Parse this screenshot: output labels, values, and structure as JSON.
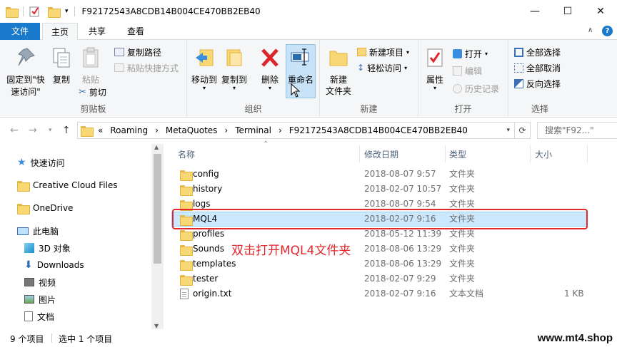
{
  "window": {
    "title": "F92172543A8CDB14B004CE470BB2EB40",
    "minimize": "—",
    "maximize": "☐",
    "close": "✕"
  },
  "ribbon_tabs": {
    "file": "文件",
    "home": "主页",
    "share": "共享",
    "view": "查看"
  },
  "ribbon": {
    "clipboard": {
      "label": "剪贴板",
      "pin_quick_access": "固定到\"快速访问\"",
      "copy": "复制",
      "paste": "粘贴",
      "copy_path": "复制路径",
      "paste_shortcut": "粘贴快捷方式",
      "cut": "剪切"
    },
    "organize": {
      "label": "组织",
      "move_to": "移动到",
      "copy_to": "复制到",
      "delete": "删除",
      "rename": "重命名"
    },
    "new": {
      "label": "新建",
      "new_folder": "新建\n文件夹",
      "new_item": "新建项目",
      "easy_access": "轻松访问"
    },
    "open": {
      "label": "打开",
      "properties": "属性",
      "open": "打开",
      "edit": "编辑",
      "history": "历史记录"
    },
    "select": {
      "label": "选择",
      "select_all": "全部选择",
      "select_none": "全部取消",
      "invert": "反向选择"
    }
  },
  "address": {
    "prefix": "«",
    "crumbs": [
      "Roaming",
      "MetaQuotes",
      "Terminal",
      "F92172543A8CDB14B004CE470BB2EB40"
    ],
    "separator": "›",
    "search_placeholder": "搜索\"F92...\""
  },
  "nav": {
    "items": [
      {
        "label": "快速访问",
        "icon": "star-icon"
      },
      {
        "label": "Creative Cloud Files",
        "icon": "creative-cloud-icon"
      },
      {
        "label": "OneDrive",
        "icon": "folder-icon"
      },
      {
        "label": "此电脑",
        "icon": "computer-icon"
      },
      {
        "label": "3D 对象",
        "icon": "3d-objects-icon"
      },
      {
        "label": "Downloads",
        "icon": "download-icon"
      },
      {
        "label": "视频",
        "icon": "video-icon"
      },
      {
        "label": "图片",
        "icon": "picture-icon"
      },
      {
        "label": "文档",
        "icon": "document-icon"
      }
    ]
  },
  "columns": {
    "name": "名称",
    "modified": "修改日期",
    "type": "类型",
    "size": "大小"
  },
  "files": [
    {
      "name": "config",
      "modified": "2018-08-07 9:57",
      "type": "文件夹",
      "size": ""
    },
    {
      "name": "history",
      "modified": "2018-02-07 10:57",
      "type": "文件夹",
      "size": ""
    },
    {
      "name": "logs",
      "modified": "2018-08-07 9:54",
      "type": "文件夹",
      "size": ""
    },
    {
      "name": "MQL4",
      "modified": "2018-02-07 9:16",
      "type": "文件夹",
      "size": ""
    },
    {
      "name": "profiles",
      "modified": "2018-05-12 11:39",
      "type": "文件夹",
      "size": ""
    },
    {
      "name": "Sounds",
      "modified": "2018-08-06 13:29",
      "type": "文件夹",
      "size": ""
    },
    {
      "name": "templates",
      "modified": "2018-08-06 13:29",
      "type": "文件夹",
      "size": ""
    },
    {
      "name": "tester",
      "modified": "2018-02-07 9:29",
      "type": "文件夹",
      "size": ""
    },
    {
      "name": "origin.txt",
      "modified": "2018-02-07 9:16",
      "type": "文本文档",
      "size": "1 KB"
    }
  ],
  "annotation": "双击打开MQL4文件夹",
  "status": {
    "item_count": "9 个项目",
    "selected": "选中 1 个项目"
  },
  "watermark": "www.mt4.shop",
  "colors": {
    "accent": "#1979ca",
    "selection": "#cce8ff",
    "annotation_red": "#e0282e"
  }
}
